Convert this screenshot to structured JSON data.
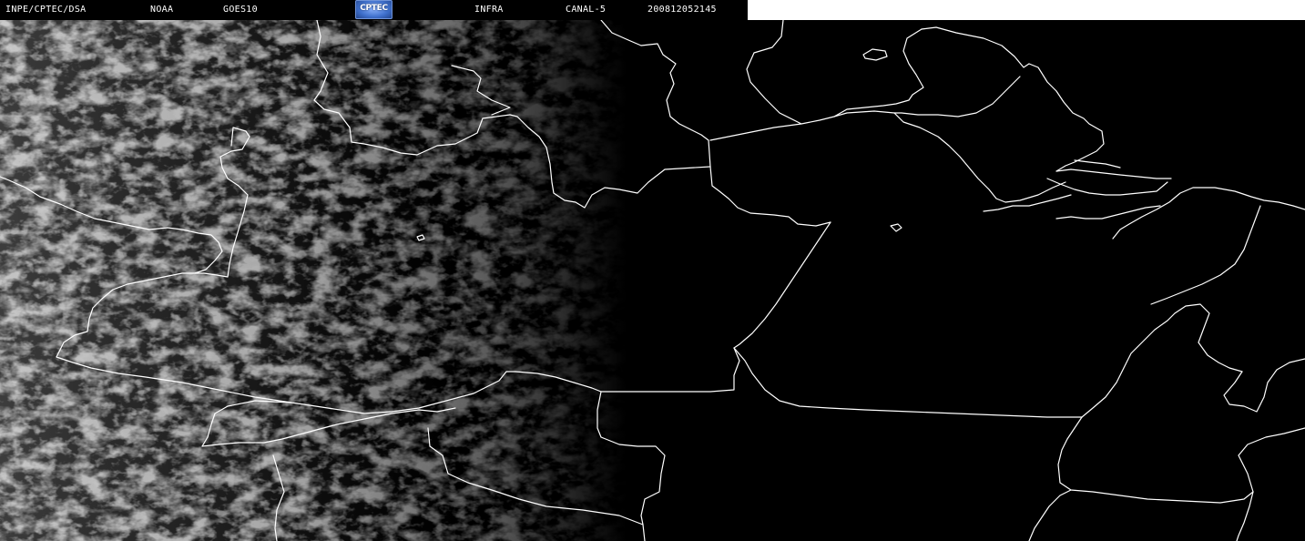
{
  "header": {
    "institution": "INPE/CPTEC/DSA",
    "agency": "NOAA",
    "satellite": "GOES10",
    "logo_text": "CPTEC",
    "product": "INFRA",
    "channel": "CANAL-5",
    "timestamp": "200812052145"
  },
  "image": {
    "background_color": "#000000",
    "border_line_color": "#ffffff",
    "cloud_color": "#8a8a8a",
    "header_blank_color": "#ffffff"
  }
}
